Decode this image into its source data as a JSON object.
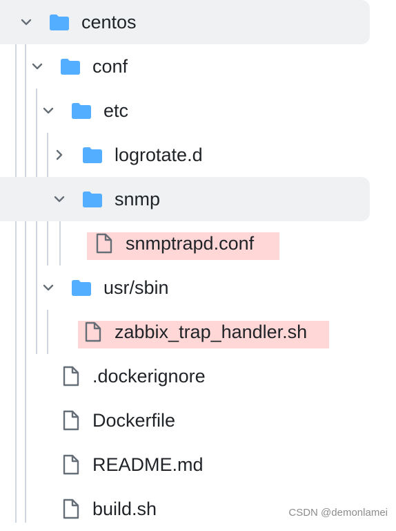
{
  "tree": {
    "items": [
      {
        "label": "centos",
        "type": "folder",
        "state": "expanded"
      },
      {
        "label": "conf",
        "type": "folder",
        "state": "expanded"
      },
      {
        "label": "etc",
        "type": "folder",
        "state": "expanded"
      },
      {
        "label": "logrotate.d",
        "type": "folder",
        "state": "collapsed"
      },
      {
        "label": "snmp",
        "type": "folder",
        "state": "expanded",
        "selected": true
      },
      {
        "label": "snmptrapd.conf",
        "type": "file",
        "highlighted": true
      },
      {
        "label": "usr/sbin",
        "type": "folder",
        "state": "expanded"
      },
      {
        "label": "zabbix_trap_handler.sh",
        "type": "file",
        "highlighted": true
      },
      {
        "label": ".dockerignore",
        "type": "file"
      },
      {
        "label": "Dockerfile",
        "type": "file"
      },
      {
        "label": "README.md",
        "type": "file"
      },
      {
        "label": "build.sh",
        "type": "file"
      }
    ]
  },
  "colors": {
    "folder_icon": "#54aeff",
    "file_icon": "#656d76",
    "highlight": "#ffd7d7",
    "selected_row": "#eff1f3",
    "guide": "#d0d7de",
    "text": "#1f2328"
  },
  "watermark": "CSDN @demonlamei"
}
